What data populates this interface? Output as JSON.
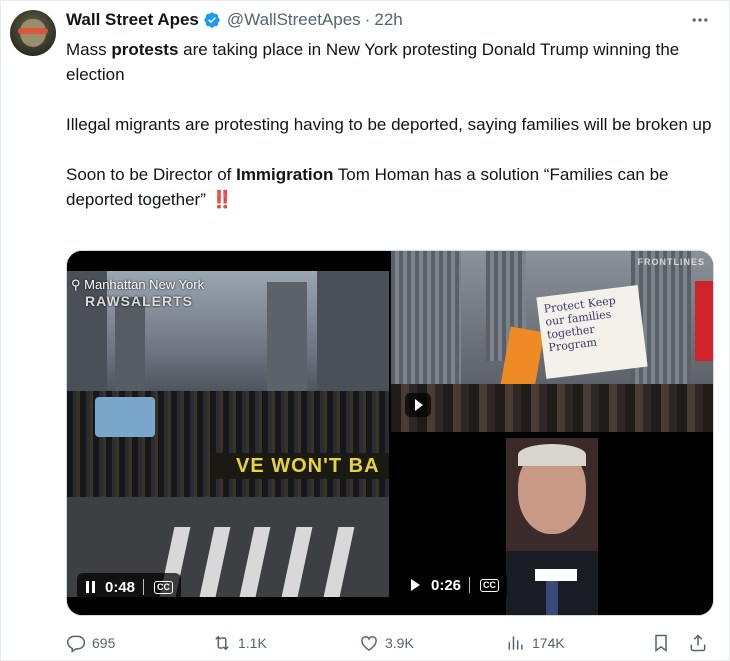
{
  "author": {
    "name": "Wall Street Apes",
    "handle": "@WallStreetApes",
    "separator": "·",
    "time": "22h"
  },
  "tweet": {
    "p1_pre": "Mass ",
    "p1_bold": "protests",
    "p1_post": " are taking place in New York protesting Donald Trump winning the election",
    "p2": "Illegal migrants are protesting having to be deported, saying families will be broken up",
    "p3_pre": "Soon to be Director of ",
    "p3_bold": "Immigration",
    "p3_post": " Tom Homan has a solution “Families can be deported together”",
    "emoji": "‼️"
  },
  "media": {
    "video1": {
      "location": "Manhattan New York",
      "watermark": "RAWSALERTS",
      "banner": "VE WON'T BA",
      "state": "playing",
      "duration": "0:48",
      "cc": "CC"
    },
    "video2": {
      "watermark": "FRONTLINES",
      "sign": "Protect Keep our families together Program"
    },
    "video3": {
      "state": "paused",
      "duration": "0:26",
      "cc": "CC"
    }
  },
  "actions": {
    "replies": "695",
    "reposts": "1.1K",
    "likes": "3.9K",
    "views": "174K"
  },
  "colors": {
    "text": "#0f1419",
    "secondary": "#536471",
    "verified": "#1d9bf0",
    "emoji_red": "#e0263b"
  },
  "icons": [
    "verified-icon",
    "more-icon",
    "location-pin-icon",
    "pause-icon",
    "play-icon",
    "cc-icon",
    "reply-icon",
    "repost-icon",
    "like-icon",
    "views-icon",
    "bookmark-icon",
    "share-icon"
  ]
}
